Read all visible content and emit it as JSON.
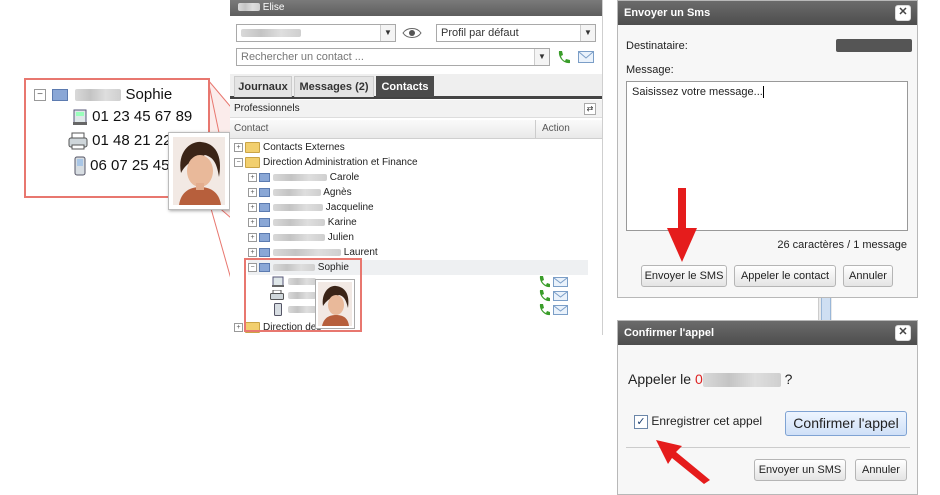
{
  "colors": {
    "accent_red": "#e8776f",
    "arrow_red": "#e51c1c",
    "titlebar": "#4d4d4d",
    "phone_green": "#3a9d2a"
  },
  "zoom": {
    "name": "Sophie",
    "numbers": [
      "01 23 45 67 89",
      "01 48 21 22",
      "06 07 25 45"
    ],
    "icons": [
      "landline-phone-icon",
      "fax-icon",
      "mobile-phone-icon"
    ]
  },
  "panel": {
    "title": "Elise",
    "profile_select": "Profil par défaut",
    "search": {
      "placeholder": "Rechercher un contact ..."
    },
    "tabs": [
      {
        "label": "Journaux"
      },
      {
        "label": "Messages (2)"
      },
      {
        "label": "Contacts",
        "active": true
      }
    ],
    "section_title": "Professionnels",
    "columns": {
      "contact": "Contact",
      "action": "Action"
    },
    "groups": {
      "external": "Contacts Externes",
      "direction": "Direction Administration et Finance",
      "direction2": "Direction des"
    },
    "contacts": [
      "Carole",
      "Agnès",
      "Jacqueline",
      "Karine",
      "Julien",
      "Laurent",
      "Sophie"
    ]
  },
  "sms_dialog": {
    "title": "Envoyer un Sms",
    "recipient_label": "Destinataire:",
    "message_label": "Message:",
    "message_value": "Saisissez votre message...",
    "counter": "26 caractères / 1 message",
    "buttons": {
      "send": "Envoyer le SMS",
      "call": "Appeler le contact",
      "cancel": "Annuler"
    }
  },
  "call_dialog": {
    "title": "Confirmer l'appel",
    "prompt_prefix": "Appeler le ",
    "number_start": "0",
    "prompt_suffix": "?",
    "record_label": "Enregistrer cet appel",
    "record_checked": true,
    "buttons": {
      "confirm": "Confirmer l'appel",
      "sms": "Envoyer un SMS",
      "cancel": "Annuler"
    }
  }
}
